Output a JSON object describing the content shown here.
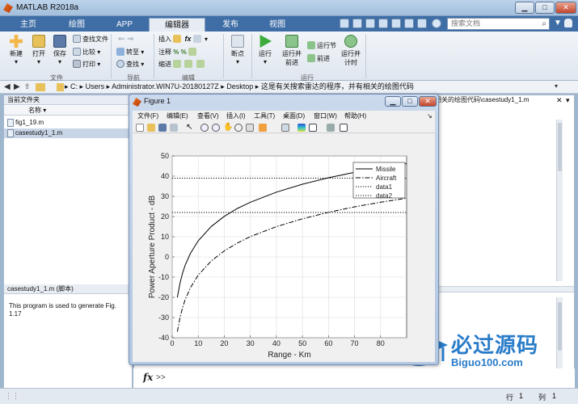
{
  "window": {
    "title": "MATLAB R2018a"
  },
  "ribbon_tabs": [
    "主页",
    "绘图",
    "APP",
    "编辑器",
    "发布",
    "视图"
  ],
  "active_tab": "编辑器",
  "search": {
    "placeholder": "搜索文档"
  },
  "ribbon": {
    "file_group": {
      "label": "文件",
      "new": "新建",
      "open": "打开",
      "save": "保存",
      "find_files": "查找文件",
      "compare": "比较",
      "print": "打印"
    },
    "nav_group": {
      "label": "导航",
      "goto": "转至",
      "find": "查找"
    },
    "edit_group": {
      "label": "编辑",
      "insert": "插入",
      "comment": "注释",
      "indent": "缩进"
    },
    "breakpoint_group": {
      "breakpoints": "断点"
    },
    "run_group": {
      "label": "运行",
      "run": "运行",
      "run_advance": "运行并前进",
      "run_section": "运行节",
      "advance": "前进",
      "run_time": "运行并计时"
    }
  },
  "address": {
    "segments": [
      "C:",
      "Users",
      "Administrator.WIN7U-20180127Z",
      "Desktop",
      "这是有关搜索雷达的程序，并有相关的绘图代码"
    ]
  },
  "left_panel": {
    "header": "当前文件夹",
    "column_name": "名称",
    "files": [
      "fig1_19.m",
      "casestudy1_1.m"
    ],
    "selected_file": "casestudy1_1.m",
    "details_header": "casestudy1_1.m  (脚本)",
    "details_text": "This program is used to generate Fig. 1.17"
  },
  "editor": {
    "tab_label": "相关的绘图代码\\casestudy1_1.m"
  },
  "command": {
    "fx": "fx",
    "prompt": ">>"
  },
  "status": {
    "row_label": "行",
    "row": "1",
    "col_label": "列",
    "col": "1"
  },
  "figure": {
    "title": "Figure 1",
    "menu": [
      "文件(F)",
      "编辑(E)",
      "查看(V)",
      "插入(I)",
      "工具(T)",
      "桌面(D)",
      "窗口(W)",
      "帮助(H)"
    ]
  },
  "chart_data": {
    "type": "line",
    "xlabel": "Range - Km",
    "ylabel": "Power Aperture Product - dB",
    "xlim": [
      0,
      90
    ],
    "ylim": [
      -40,
      50
    ],
    "xticks": [
      0,
      10,
      20,
      30,
      40,
      50,
      60,
      70,
      80
    ],
    "yticks": [
      -40,
      -30,
      -20,
      -10,
      0,
      10,
      20,
      30,
      40,
      50
    ],
    "grid": true,
    "legend_position": "top-right",
    "series": [
      {
        "name": "Missile",
        "style": "solid",
        "color": "#000000",
        "x": [
          2,
          3,
          4,
          5,
          7,
          10,
          15,
          20,
          25,
          30,
          40,
          50,
          60,
          70,
          80,
          90
        ],
        "y": [
          -20.0,
          -12.9,
          -7.9,
          -4.0,
          1.8,
          8.0,
          15.1,
          20.1,
          24.0,
          27.1,
          32.1,
          36.0,
          39.2,
          41.9,
          44.2,
          46.2
        ]
      },
      {
        "name": "Aircraft",
        "style": "dashdot",
        "color": "#000000",
        "x": [
          2,
          3,
          4,
          5,
          7,
          10,
          15,
          20,
          25,
          30,
          40,
          50,
          60,
          70,
          80,
          90
        ],
        "y": [
          -37.0,
          -30.0,
          -25.0,
          -21.1,
          -15.2,
          -9.0,
          -2.0,
          3.0,
          6.9,
          10.1,
          15.0,
          18.9,
          22.1,
          24.8,
          27.1,
          29.1
        ]
      },
      {
        "name": "data1",
        "style": "dotted",
        "color": "#000000",
        "x": [
          0,
          90
        ],
        "y": [
          39,
          39
        ]
      },
      {
        "name": "data2",
        "style": "dotted",
        "color": "#000000",
        "x": [
          0,
          90
        ],
        "y": [
          22,
          22
        ]
      }
    ]
  },
  "watermark": {
    "text_cn": "必过源码",
    "text_url": "Biguo100.com"
  }
}
